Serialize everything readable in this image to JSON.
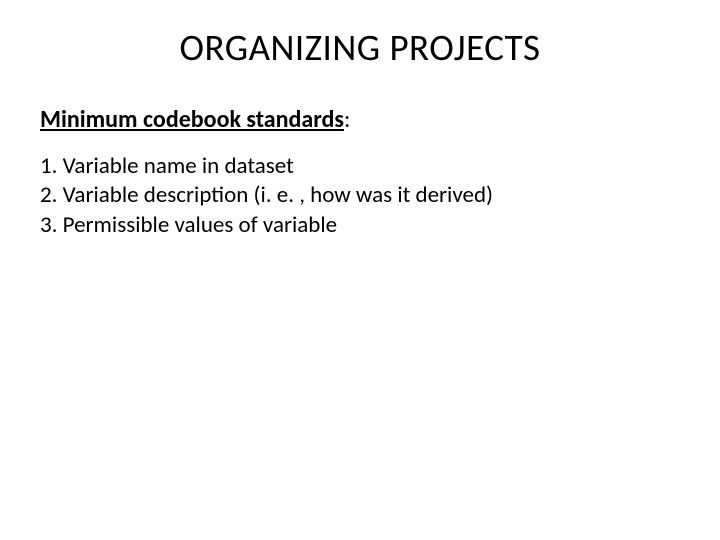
{
  "title": "ORGANIZING PROJECTS",
  "subtitle": {
    "bold_part": "Minimum codebook standards",
    "colon": ":"
  },
  "items": [
    "1. Variable name in dataset",
    "2. Variable description (i. e. , how was it derived)",
    "3. Permissible values of variable"
  ]
}
